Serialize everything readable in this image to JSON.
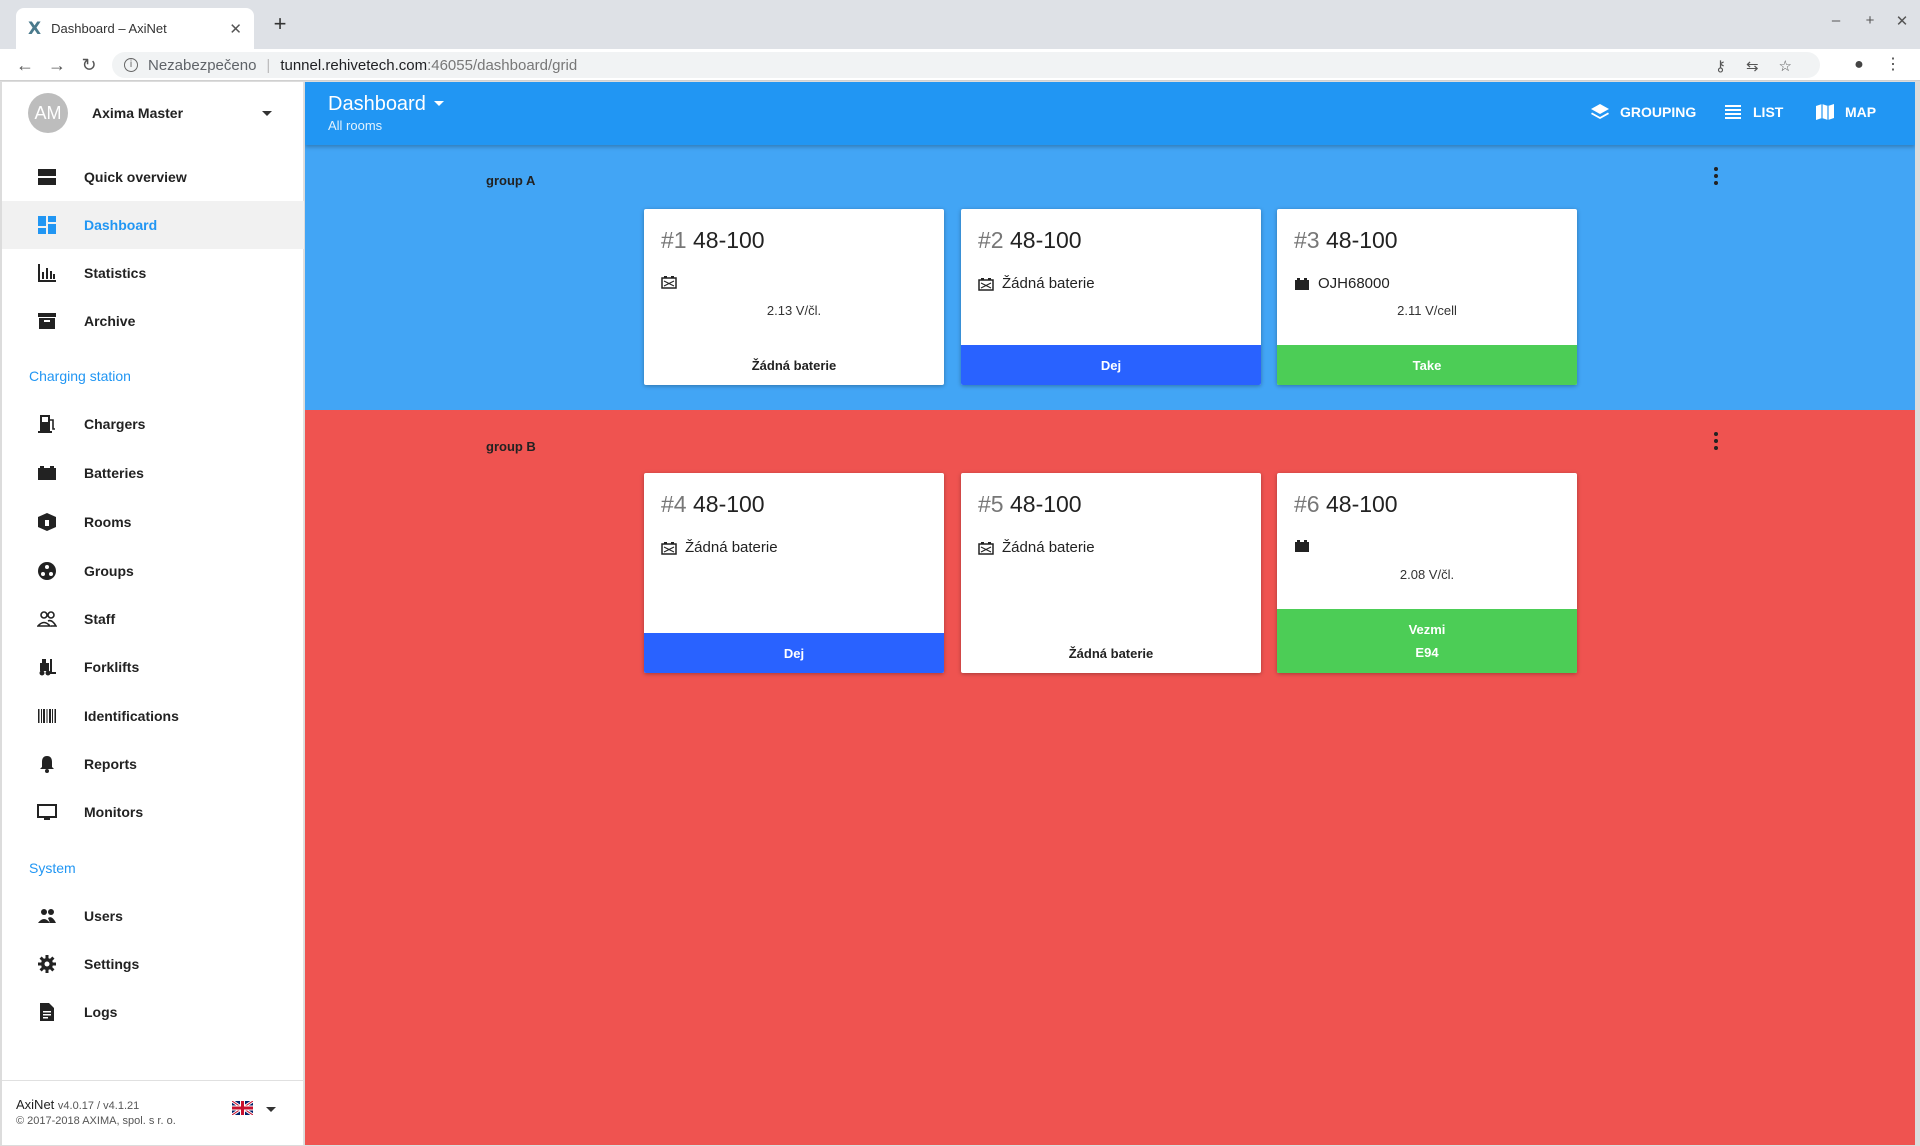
{
  "browser": {
    "tab_title": "Dashboard – AxiNet",
    "tab_favicon": "X",
    "not_secure": "Nezabezpečeno",
    "url_host": "tunnel.rehivetech.com",
    "url_path": ":46055/dashboard/grid"
  },
  "user": {
    "initials": "AM",
    "name": "Axima Master"
  },
  "nav": {
    "main": [
      {
        "label": "Quick overview",
        "icon": "quick-overview-icon"
      },
      {
        "label": "Dashboard",
        "icon": "dashboard-icon",
        "active": true
      },
      {
        "label": "Statistics",
        "icon": "statistics-icon"
      },
      {
        "label": "Archive",
        "icon": "archive-icon"
      }
    ],
    "charging_title": "Charging station",
    "charging": [
      {
        "label": "Chargers",
        "icon": "charger-icon"
      },
      {
        "label": "Batteries",
        "icon": "battery-icon"
      },
      {
        "label": "Rooms",
        "icon": "rooms-icon"
      },
      {
        "label": "Groups",
        "icon": "groups-icon"
      },
      {
        "label": "Staff",
        "icon": "staff-icon"
      },
      {
        "label": "Forklifts",
        "icon": "forklift-icon"
      },
      {
        "label": "Identifications",
        "icon": "barcode-icon"
      },
      {
        "label": "Reports",
        "icon": "bell-icon"
      },
      {
        "label": "Monitors",
        "icon": "monitor-icon"
      }
    ],
    "system_title": "System",
    "system": [
      {
        "label": "Users",
        "icon": "users-icon"
      },
      {
        "label": "Settings",
        "icon": "gear-icon"
      },
      {
        "label": "Logs",
        "icon": "document-icon"
      }
    ]
  },
  "footer": {
    "app": "AxiNet",
    "version": "v4.0.17 / v4.1.21",
    "copyright": "© 2017-2018 AXIMA, spol. s r. o."
  },
  "appbar": {
    "title": "Dashboard",
    "subtitle": "All rooms",
    "grouping": "GROUPING",
    "list": "LIST",
    "map": "MAP"
  },
  "groups": [
    {
      "name": "group A",
      "color": "#42a5f5",
      "cards": [
        {
          "num": "#1",
          "type": "48-100",
          "battery": "",
          "voltage": "2.13 V/čl.",
          "action": "Žádná baterie",
          "action_sub": ""
        },
        {
          "num": "#2",
          "type": "48-100",
          "battery": "Žádná baterie",
          "voltage": "",
          "action": "Dej",
          "action_sub": ""
        },
        {
          "num": "#3",
          "type": "48-100",
          "battery": "OJH68000",
          "voltage": "2.11 V/cell",
          "action": "Take",
          "action_sub": ""
        }
      ]
    },
    {
      "name": "group B",
      "color": "#ef5350",
      "cards": [
        {
          "num": "#4",
          "type": "48-100",
          "battery": "Žádná baterie",
          "voltage": "",
          "action": "Dej",
          "action_sub": ""
        },
        {
          "num": "#5",
          "type": "48-100",
          "battery": "Žádná baterie",
          "voltage": "",
          "action": "Žádná baterie",
          "action_sub": ""
        },
        {
          "num": "#6",
          "type": "48-100",
          "battery": "",
          "voltage": "2.08 V/čl.",
          "action": "Vezmi",
          "action_sub": "E94"
        }
      ]
    }
  ],
  "colors": {
    "action_blue": "#2962ff",
    "action_green": "#4ccd56",
    "accent": "#2196f3"
  }
}
